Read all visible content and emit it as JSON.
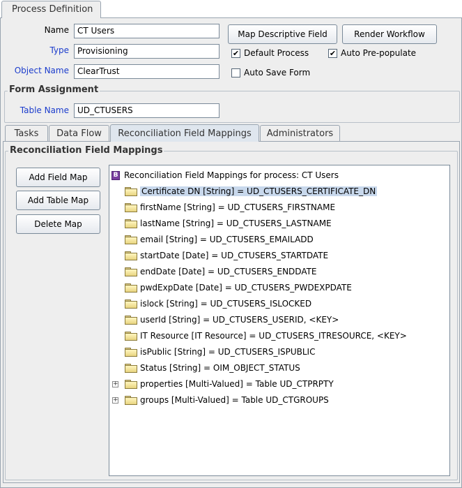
{
  "header": {
    "tab_label": "Process Definition"
  },
  "process": {
    "name_label": "Name",
    "name_value": "CT Users",
    "type_label": "Type",
    "type_value": "Provisioning",
    "object_label": "Object Name",
    "object_value": "ClearTrust",
    "map_button": "Map Descriptive Field",
    "render_button": "Render Workflow",
    "default_process_label": "Default Process",
    "default_process_checked": true,
    "auto_prepopulate_label": "Auto Pre-populate",
    "auto_prepopulate_checked": true,
    "auto_save_label": "Auto Save Form",
    "auto_save_checked": false
  },
  "form_assignment": {
    "title": "Form Assignment",
    "table_label": "Table Name",
    "table_value": "UD_CTUSERS"
  },
  "tabs": [
    {
      "label": "Tasks"
    },
    {
      "label": "Data Flow"
    },
    {
      "label": "Reconciliation Field Mappings"
    },
    {
      "label": "Administrators"
    }
  ],
  "recon": {
    "title": "Reconciliation Field Mappings",
    "add_field_map": "Add Field Map",
    "add_table_map": "Add Table Map",
    "delete_map": "Delete Map",
    "root_label": "Reconciliation Field Mappings for process: CT Users",
    "items": [
      {
        "label": "Certificate DN [String] = UD_CTUSERS_CERTIFICATE_DN"
      },
      {
        "label": "firstName [String] = UD_CTUSERS_FIRSTNAME"
      },
      {
        "label": "lastName [String] = UD_CTUSERS_LASTNAME"
      },
      {
        "label": "email [String] = UD_CTUSERS_EMAILADD"
      },
      {
        "label": "startDate [Date] = UD_CTUSERS_STARTDATE"
      },
      {
        "label": "endDate [Date] = UD_CTUSERS_ENDDATE"
      },
      {
        "label": "pwdExpDate [Date] = UD_CTUSERS_PWDEXPDATE"
      },
      {
        "label": "islock [String] = UD_CTUSERS_ISLOCKED"
      },
      {
        "label": "userId [String] = UD_CTUSERS_USERID, <KEY>"
      },
      {
        "label": "IT Resource [IT Resource] = UD_CTUSERS_ITRESOURCE, <KEY>"
      },
      {
        "label": "isPublic [String] = UD_CTUSERS_ISPUBLIC"
      },
      {
        "label": "Status [String] = OIM_OBJECT_STATUS"
      },
      {
        "label": "properties [Multi-Valued] = Table UD_CTPRPTY"
      },
      {
        "label": "groups [Multi-Valued] = Table UD_CTGROUPS"
      }
    ]
  }
}
